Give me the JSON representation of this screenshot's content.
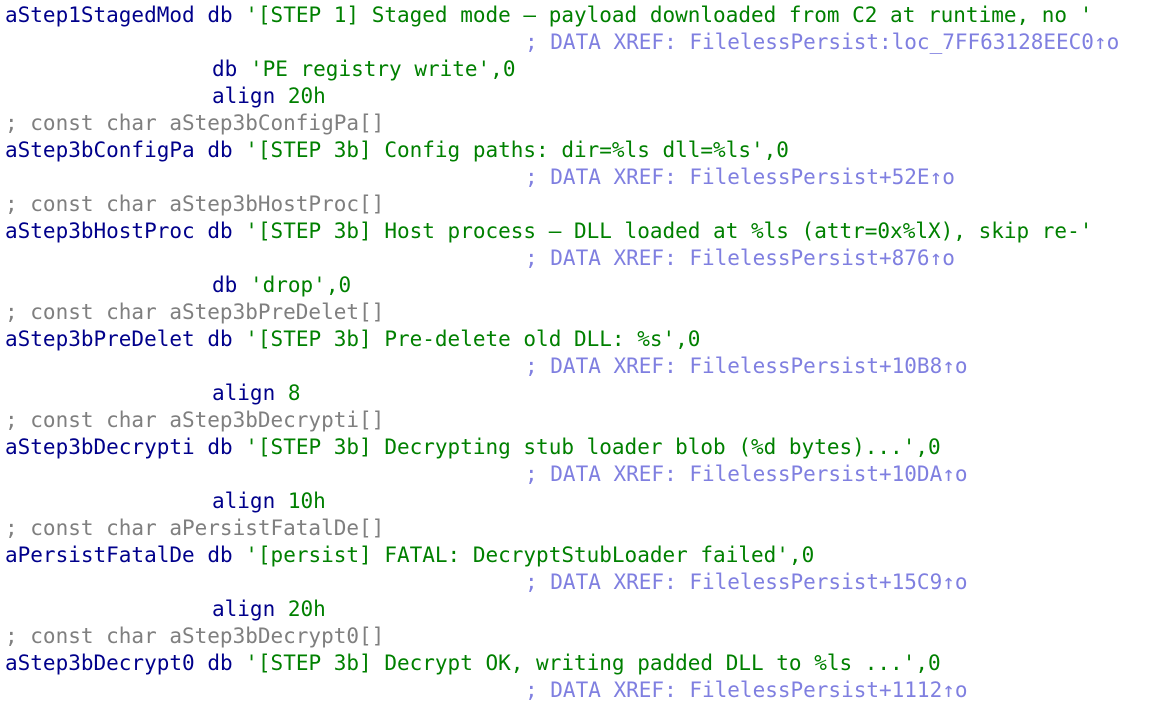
{
  "lines": [
    {
      "kind": "def",
      "name": "aStep1StagedMod",
      "op": "db",
      "arg": "'[STEP 1] Staged mode — payload downloaded from C2 at runtime, no '",
      "tail": ""
    },
    {
      "kind": "xref",
      "text": "; DATA XREF: FilelessPersist:loc_7FF63128EEC0↑o"
    },
    {
      "kind": "cont",
      "op": "db",
      "arg": "'PE registry write'",
      "tail": ",0"
    },
    {
      "kind": "cont",
      "op": "align",
      "arg": "20h",
      "tail": ""
    },
    {
      "kind": "comment",
      "text": "; const char aStep3bConfigPa[]"
    },
    {
      "kind": "def",
      "name": "aStep3bConfigPa",
      "op": "db",
      "arg": "'[STEP 3b] Config paths: dir=%ls dll=%ls'",
      "tail": ",0"
    },
    {
      "kind": "xref",
      "text": "; DATA XREF: FilelessPersist+52E↑o"
    },
    {
      "kind": "comment",
      "text": "; const char aStep3bHostProc[]"
    },
    {
      "kind": "def",
      "name": "aStep3bHostProc",
      "op": "db",
      "arg": "'[STEP 3b] Host process — DLL loaded at %ls (attr=0x%lX), skip re-'",
      "tail": ""
    },
    {
      "kind": "xref",
      "text": "; DATA XREF: FilelessPersist+876↑o"
    },
    {
      "kind": "cont",
      "op": "db",
      "arg": "'drop'",
      "tail": ",0"
    },
    {
      "kind": "comment",
      "text": "; const char aStep3bPreDelet[]"
    },
    {
      "kind": "def",
      "name": "aStep3bPreDelet",
      "op": "db",
      "arg": "'[STEP 3b] Pre-delete old DLL: %s'",
      "tail": ",0"
    },
    {
      "kind": "xref",
      "text": "; DATA XREF: FilelessPersist+10B8↑o"
    },
    {
      "kind": "cont",
      "op": "align",
      "arg": "8",
      "tail": ""
    },
    {
      "kind": "comment",
      "text": "; const char aStep3bDecrypti[]"
    },
    {
      "kind": "def",
      "name": "aStep3bDecrypti",
      "op": "db",
      "arg": "'[STEP 3b] Decrypting stub loader blob (%d bytes)...'",
      "tail": ",0"
    },
    {
      "kind": "xref",
      "text": "; DATA XREF: FilelessPersist+10DA↑o"
    },
    {
      "kind": "cont",
      "op": "align",
      "arg": "10h",
      "tail": ""
    },
    {
      "kind": "comment",
      "text": "; const char aPersistFatalDe[]"
    },
    {
      "kind": "def",
      "name": "aPersistFatalDe",
      "op": "db",
      "arg": "'[persist] FATAL: DecryptStubLoader failed'",
      "tail": ",0"
    },
    {
      "kind": "xref",
      "text": "; DATA XREF: FilelessPersist+15C9↑o"
    },
    {
      "kind": "cont",
      "op": "align",
      "arg": "20h",
      "tail": ""
    },
    {
      "kind": "comment",
      "text": "; const char aStep3bDecrypt0[]"
    },
    {
      "kind": "def",
      "name": "aStep3bDecrypt0",
      "op": "db",
      "arg": "'[STEP 3b] Decrypt OK, writing padded DLL to %ls ...'",
      "tail": ",0"
    },
    {
      "kind": "xref",
      "text": "; DATA XREF: FilelessPersist+1112↑o"
    }
  ]
}
